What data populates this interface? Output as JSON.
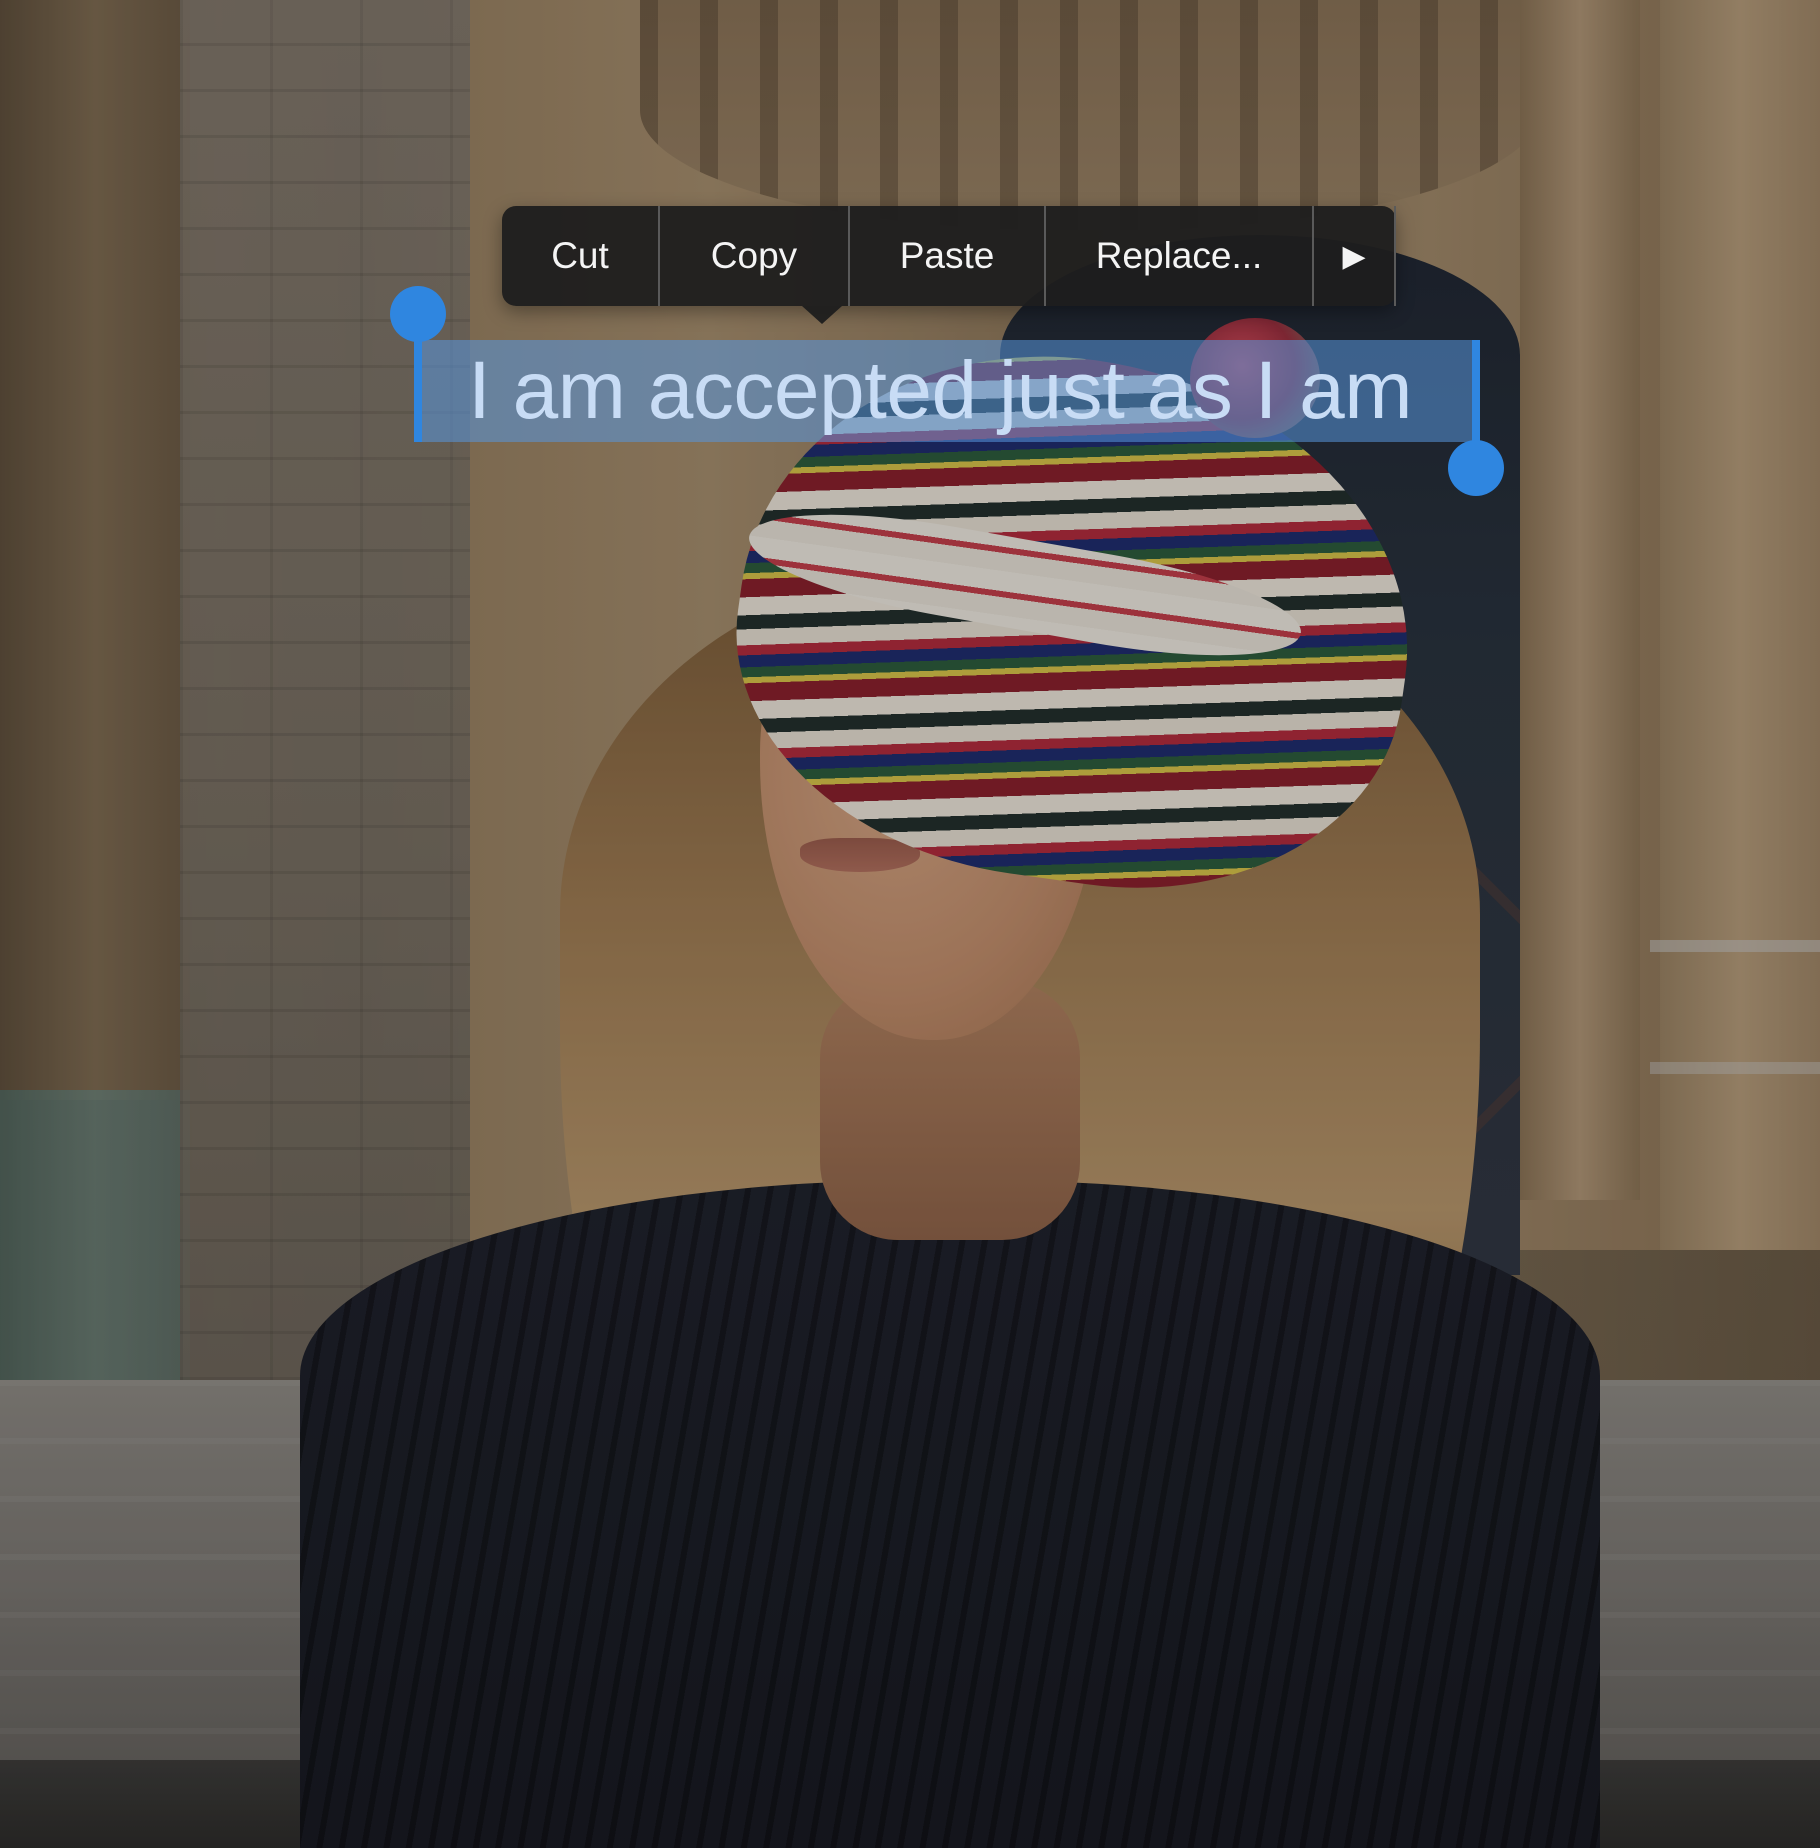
{
  "selection": {
    "text": "I am accepted just as I am",
    "highlight_color": "#5896DC",
    "handle_color": "#2F86E0"
  },
  "edit_menu": {
    "items": [
      {
        "label": "Cut"
      },
      {
        "label": "Copy"
      },
      {
        "label": "Paste"
      },
      {
        "label": "Replace..."
      }
    ],
    "more_icon": "play-right-triangle-icon",
    "more_glyph": "▶",
    "background": "#1E1E1E",
    "text_color": "#F4F4F4"
  },
  "photo": {
    "subject": "woman in striped knit beret in front of stone church doorway"
  }
}
